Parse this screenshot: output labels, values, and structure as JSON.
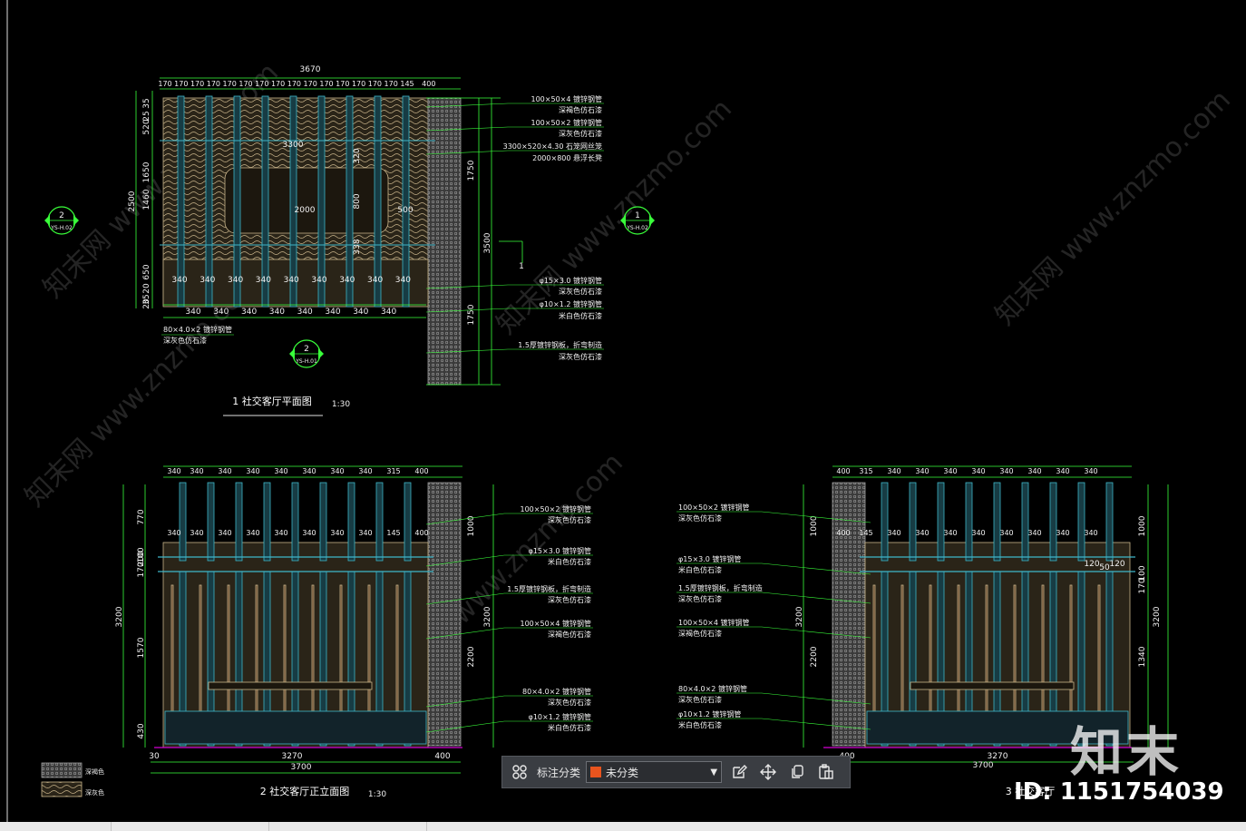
{
  "plan": {
    "title": "1 社交客厅平面图",
    "scale": "1:30",
    "top_total": "3670",
    "top_segments": [
      "170",
      "170",
      "170",
      "170",
      "170",
      "170",
      "170",
      "170",
      "170",
      "170",
      "170",
      "170",
      "170",
      "170",
      "170",
      "145",
      "400"
    ],
    "left_dims": [
      "35",
      "25",
      "520",
      "1650",
      "1460",
      "2500",
      "650",
      "20",
      "35",
      "20"
    ],
    "inner_labels": [
      "3300",
      "2000",
      "320",
      "800",
      "338",
      "500"
    ],
    "row_340_upper": [
      "340",
      "340",
      "340",
      "340",
      "340",
      "340",
      "340",
      "340",
      "340"
    ],
    "row_340_lower": [
      "340",
      "340",
      "340",
      "340",
      "340",
      "340",
      "340",
      "340"
    ],
    "right_dims": [
      "1750",
      "3500",
      "1750"
    ],
    "marker_1": "1",
    "callouts": [
      "100×50×4 镀锌钢管",
      "深褐色仿石漆",
      "100×50×2 镀锌钢管",
      "深灰色仿石漆",
      "3300×520×4.30 石笼网丝笼",
      "2000×800 悬浮长凳",
      "φ15×3.0 镀锌钢管",
      "深灰色仿石漆",
      "φ10×1.2 镀锌钢管",
      "米白色仿石漆",
      "1.5厚镀锌钢板，折弯制造",
      "深灰色仿石漆"
    ],
    "bottom_left_note": [
      "80×4.0×2 镀锌钢管",
      "深灰色仿石漆"
    ],
    "section_markers": [
      {
        "num": "2",
        "ref": "YS-H.02"
      },
      {
        "num": "1",
        "ref": "YS-H.02"
      },
      {
        "num": "2",
        "ref": "YS-H.01"
      }
    ]
  },
  "elev_front": {
    "title": "2 社交客厅正立面图",
    "scale": "1:30",
    "top_segments": [
      "340",
      "340",
      "340",
      "340",
      "340",
      "340",
      "340",
      "340",
      "315",
      "400"
    ],
    "second_row": [
      "340",
      "340",
      "340",
      "340",
      "340",
      "340",
      "340",
      "340",
      "145",
      "400"
    ],
    "left_dims": [
      "770",
      "100",
      "200",
      "170",
      "3200",
      "1570",
      "430"
    ],
    "right_dims": [
      "1000",
      "3200",
      "2200"
    ],
    "bottom": [
      "30",
      "3270",
      "400",
      "3700"
    ],
    "callouts": [
      "100×50×2 镀锌钢管",
      "深灰色仿石漆",
      "φ15×3.0 镀锌钢管",
      "米白色仿石漆",
      "1.5厚镀锌钢板，折弯制造",
      "深灰色仿石漆",
      "100×50×4 镀锌钢管",
      "深褐色仿石漆",
      "80×4.0×2 镀锌钢管",
      "深灰色仿石漆",
      "φ10×1.2 镀锌钢管",
      "米白色仿石漆"
    ]
  },
  "elev_side": {
    "title": "3 社交客厅",
    "top_segments": [
      "400",
      "315",
      "340",
      "340",
      "340",
      "340",
      "340",
      "340",
      "340",
      "340"
    ],
    "second_row": [
      "400",
      "145",
      "340",
      "340",
      "340",
      "340",
      "340",
      "340",
      "340",
      "340"
    ],
    "small_dims": [
      "120",
      "50",
      "120"
    ],
    "left_dims": [
      "1000",
      "3200",
      "2200"
    ],
    "right_dims": [
      "1000",
      "100",
      "170",
      "3200",
      "1340"
    ],
    "bottom": [
      "400",
      "3270",
      "3700"
    ],
    "callouts": [
      "100×50×2 镀锌钢管",
      "深灰色仿石漆",
      "φ15×3.0 镀锌钢管",
      "米白色仿石漆",
      "1.5厚镀锌钢板，折弯制造",
      "深灰色仿石漆",
      "100×50×4 镀锌钢管",
      "深褐色仿石漆",
      "80×4.0×2 镀锌钢管",
      "深灰色仿石漆",
      "φ10×1.2 镀锌钢管",
      "米白色仿石漆"
    ]
  },
  "legend": [
    "深褐色",
    "深灰色"
  ],
  "toolbar": {
    "label": "标注分类",
    "layer_value": "未分类",
    "layer_color": "#e8541e",
    "icons": [
      "grid-icon",
      "edit-icon",
      "move-icon",
      "copy-icon",
      "paste-icon"
    ]
  },
  "watermark": {
    "logo": "知末",
    "id": "ID: 1151754039",
    "site": "www.znzmo.com",
    "site_cn": "知末网"
  },
  "colors": {
    "line": "#39ff3a",
    "text": "#f2f2f2",
    "steel": "#3fb6c9",
    "wood": "#c9b48a",
    "stone": "#8a8a8a",
    "magenta": "#d400d4"
  }
}
